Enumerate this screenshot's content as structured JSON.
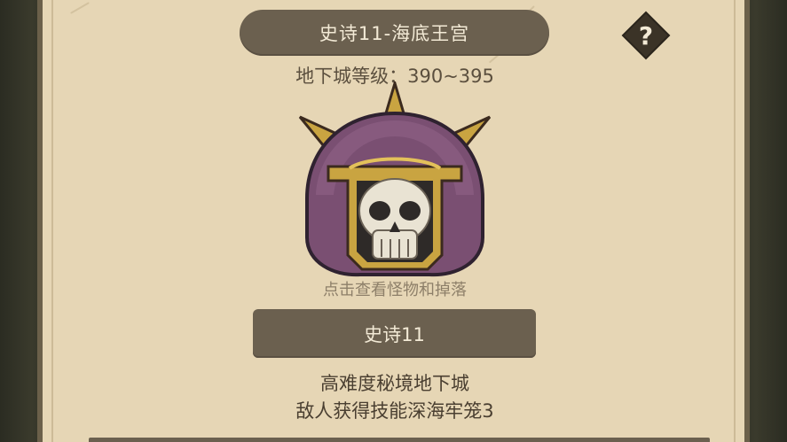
{
  "dungeon": {
    "title": "史诗11-海底王宫",
    "level_label": "地下城等级：",
    "level_range": "390~395",
    "help_glyph": "?",
    "boss_icon": "skull-helmet-icon",
    "hint": "点击查看怪物和掉落",
    "difficulty_button": "史诗11",
    "description_line1": "高难度秘境地下城",
    "description_line2": "敌人获得技能深海牢笼3"
  },
  "colors": {
    "panel": "#e6d6b5",
    "button": "#6b604f",
    "button_text": "#f3ead6",
    "help_badge": "#3b3327",
    "helmet": "#7a4f72",
    "helmet_trim": "#c9a441"
  }
}
